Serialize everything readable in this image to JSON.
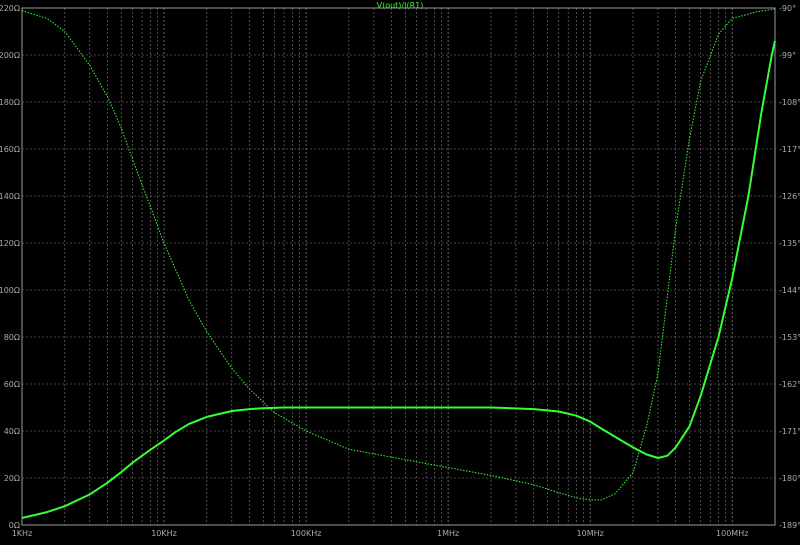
{
  "chart_data": {
    "type": "line",
    "title": "V(out)/I(R1)",
    "x_scale": "log",
    "xlim": [
      1000,
      200000000
    ],
    "x_ticks": [
      {
        "value": 1000,
        "label": "1KHz"
      },
      {
        "value": 10000,
        "label": "10KHz"
      },
      {
        "value": 100000,
        "label": "100KHz"
      },
      {
        "value": 1000000,
        "label": "1MHz"
      },
      {
        "value": 10000000,
        "label": "10MHz"
      },
      {
        "value": 100000000,
        "label": "100MHz"
      }
    ],
    "y_left": {
      "lim": [
        0,
        220
      ],
      "ticks": [
        0,
        20,
        40,
        60,
        80,
        100,
        120,
        140,
        160,
        180,
        200,
        220
      ],
      "tick_labels": [
        "0Ω",
        "20Ω",
        "40Ω",
        "60Ω",
        "80Ω",
        "100Ω",
        "120Ω",
        "140Ω",
        "160Ω",
        "180Ω",
        "200Ω",
        "220Ω"
      ]
    },
    "y_right": {
      "lim": [
        -189,
        -90
      ],
      "ticks": [
        -90,
        -99,
        -108,
        -117,
        -126,
        -135,
        -144,
        -153,
        -162,
        -171,
        -180,
        -189
      ],
      "tick_labels": [
        "-90°",
        "-99°",
        "-108°",
        "-117°",
        "-126°",
        "-135°",
        "-144°",
        "-153°",
        "-162°",
        "-171°",
        "-180°",
        "-189°"
      ]
    },
    "grid": true,
    "background": "#000000",
    "grid_color": "#7f7f7f",
    "axis_text_color": "#aaaaaa",
    "title_color": "#33ff33",
    "series": [
      {
        "kind": "magnitude",
        "axis": "left",
        "color": "#33ff33",
        "style": "solid",
        "x": [
          1000,
          1500,
          2000,
          3000,
          4000,
          5000,
          6000,
          8000,
          10000,
          12000,
          15000,
          20000,
          30000,
          40000,
          50000,
          70000,
          100000,
          200000,
          500000,
          1000000,
          2000000,
          4000000,
          6000000,
          8000000,
          10000000,
          12000000,
          15000000,
          20000000,
          25000000,
          30000000,
          35000000,
          40000000,
          50000000,
          60000000,
          80000000,
          100000000,
          130000000,
          160000000,
          190000000,
          200000000
        ],
        "values": [
          3,
          5.5,
          8,
          13,
          18,
          22.5,
          26.5,
          32,
          36,
          39.5,
          43,
          46,
          48.5,
          49.3,
          49.7,
          50,
          50,
          50,
          50,
          50,
          50,
          49.3,
          48.3,
          46.5,
          44,
          41,
          37.5,
          33,
          30,
          28.5,
          29.5,
          33,
          42,
          55,
          80,
          105,
          140,
          175,
          200,
          206
        ]
      },
      {
        "kind": "phase",
        "axis": "right",
        "color": "#33ff33",
        "style": "dotted",
        "x": [
          1000,
          1500,
          2000,
          3000,
          4000,
          5000,
          6000,
          8000,
          10000,
          15000,
          20000,
          30000,
          40000,
          60000,
          100000,
          200000,
          500000,
          1000000,
          2000000,
          4000000,
          6000000,
          8000000,
          10000000,
          12000000,
          15000000,
          20000000,
          25000000,
          30000000,
          35000000,
          40000000,
          50000000,
          60000000,
          80000000,
          100000000,
          150000000,
          200000000
        ],
        "values": [
          -90.5,
          -92,
          -94.5,
          -101,
          -107,
          -113,
          -119,
          -128,
          -135,
          -146,
          -152,
          -159,
          -163,
          -167.5,
          -171,
          -174.5,
          -176.5,
          -178,
          -179.5,
          -181.3,
          -182.8,
          -183.8,
          -184.2,
          -184.2,
          -183,
          -179,
          -170,
          -160,
          -145,
          -132,
          -115,
          -104,
          -95,
          -92,
          -90.7,
          -90.2
        ]
      }
    ]
  }
}
